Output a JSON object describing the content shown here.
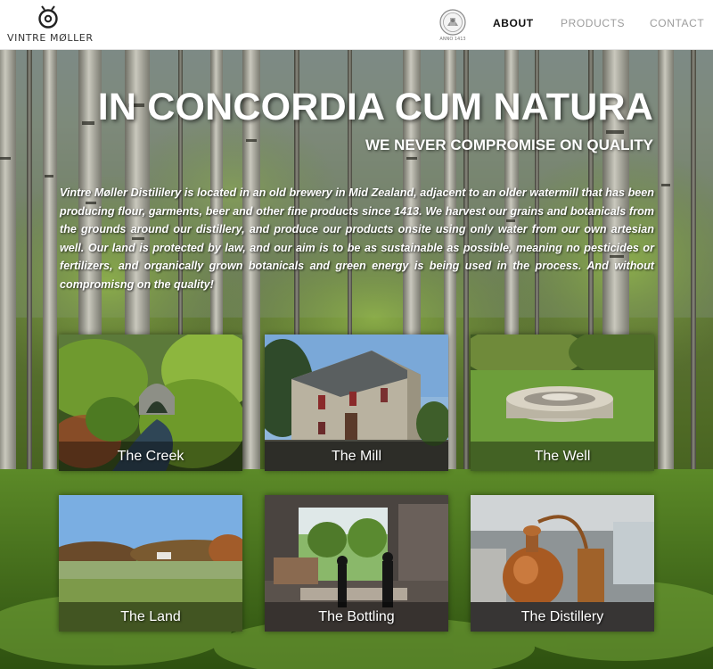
{
  "brand": {
    "name": "VINTRE MØLLER",
    "logo_icon": "mill-wheel-icon",
    "seal_icon": "anno-seal-icon",
    "seal_text": "ANNO 1413"
  },
  "nav": {
    "items": [
      {
        "label": "ABOUT",
        "active": true
      },
      {
        "label": "PRODUCTS",
        "active": false
      },
      {
        "label": "CONTACT",
        "active": false
      }
    ]
  },
  "hero": {
    "headline": "IN CONCORDIA CUM NATURA",
    "subheadline": "WE NEVER COMPROMISE ON QUALITY",
    "intro": "Vintre Møller Distililery is located in an old brewery in Mid Zealand, adjacent to an older watermill that has been producing flour, garments, beer and other fine products since 1413. We harvest our grains and botanicals from the grounds around our distillery, and produce our products onsite using only water from our own artesian well. Our land is protected by law, and our aim is to be as sustainable as possible, meaning no pesticides or fertilizers, and organically grown botanicals and green energy is being used in the process. And without compromisng on the quality!"
  },
  "tiles": [
    {
      "caption": "The Creek"
    },
    {
      "caption": "The Mill"
    },
    {
      "caption": "The Well"
    },
    {
      "caption": "The Land"
    },
    {
      "caption": "The Bottling"
    },
    {
      "caption": "The Distillery"
    }
  ],
  "colors": {
    "header_bg": "#ffffff",
    "nav_active": "#111111",
    "nav_inactive": "#9c9c9c",
    "hero_text": "#ffffff",
    "forest_green": "#4f6a25"
  }
}
